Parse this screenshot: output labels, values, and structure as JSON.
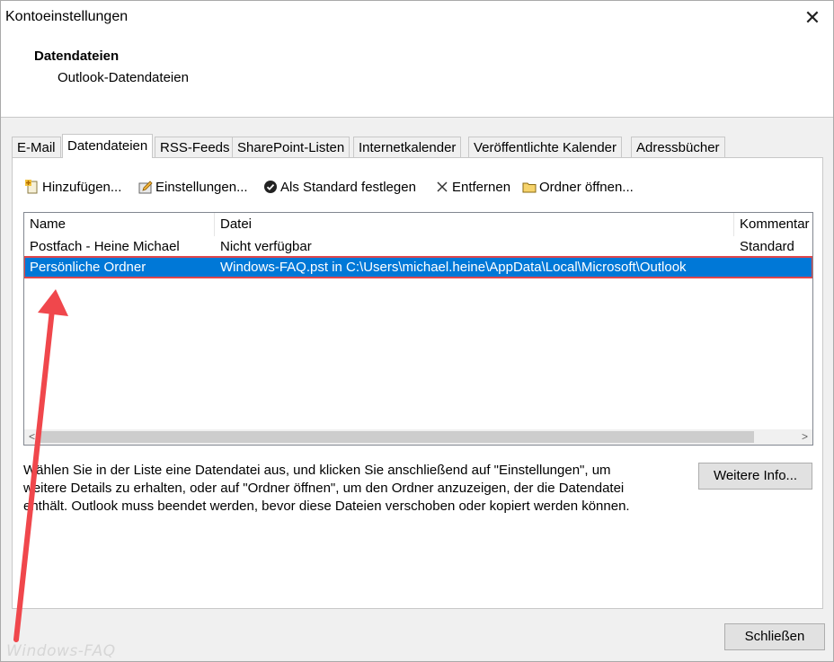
{
  "window": {
    "title": "Kontoeinstellungen",
    "close_glyph": "✕",
    "header_title": "Datendateien",
    "header_subtitle": "Outlook-Datendateien"
  },
  "tabs": [
    {
      "label": "E-Mail",
      "active": false
    },
    {
      "label": "Datendateien",
      "active": true
    },
    {
      "label": "RSS-Feeds",
      "active": false
    },
    {
      "label": "SharePoint-Listen",
      "active": false
    },
    {
      "label": "Internetkalender",
      "active": false
    },
    {
      "label": "Veröffentlichte Kalender",
      "active": false
    },
    {
      "label": "Adressbücher",
      "active": false
    }
  ],
  "toolbar": {
    "add": {
      "label": "Hinzufügen...",
      "icon": "add-datafile-icon"
    },
    "settings": {
      "label": "Einstellungen...",
      "icon": "settings-icon"
    },
    "set_default": {
      "label": "Als Standard festlegen",
      "icon": "checkmark-circle-icon"
    },
    "remove": {
      "label": "Entfernen",
      "icon": "x-icon"
    },
    "open_folder": {
      "label": "Ordner öffnen...",
      "icon": "folder-icon"
    }
  },
  "list": {
    "columns": [
      "Name",
      "Datei",
      "Kommentar"
    ],
    "rows": [
      {
        "name": "Postfach - Heine Michael",
        "file": "Nicht verfügbar",
        "comment": "Standard",
        "selected": false
      },
      {
        "name": "Persönliche Ordner",
        "file": "Windows-FAQ.pst in C:\\Users\\michael.heine\\AppData\\Local\\Microsoft\\Outlook",
        "comment": "",
        "selected": true
      }
    ],
    "scroll_left": "<",
    "scroll_right": ">"
  },
  "description": {
    "line1": "Wählen Sie in der Liste eine Datendatei aus, und klicken Sie anschließend auf \"Einstellungen\", um",
    "line2": "weitere Details zu erhalten, oder auf \"Ordner öffnen\", um den Ordner anzuzeigen, der die Datendatei",
    "line3": "enthält. Outlook muss beendet werden, bevor diese Dateien verschoben oder kopiert werden können."
  },
  "buttons": {
    "more_info": "Weitere Info...",
    "close": "Schließen"
  },
  "watermark": "Windows-FAQ",
  "colors": {
    "selection": "#0078d7",
    "annotation": "#f0474c"
  }
}
